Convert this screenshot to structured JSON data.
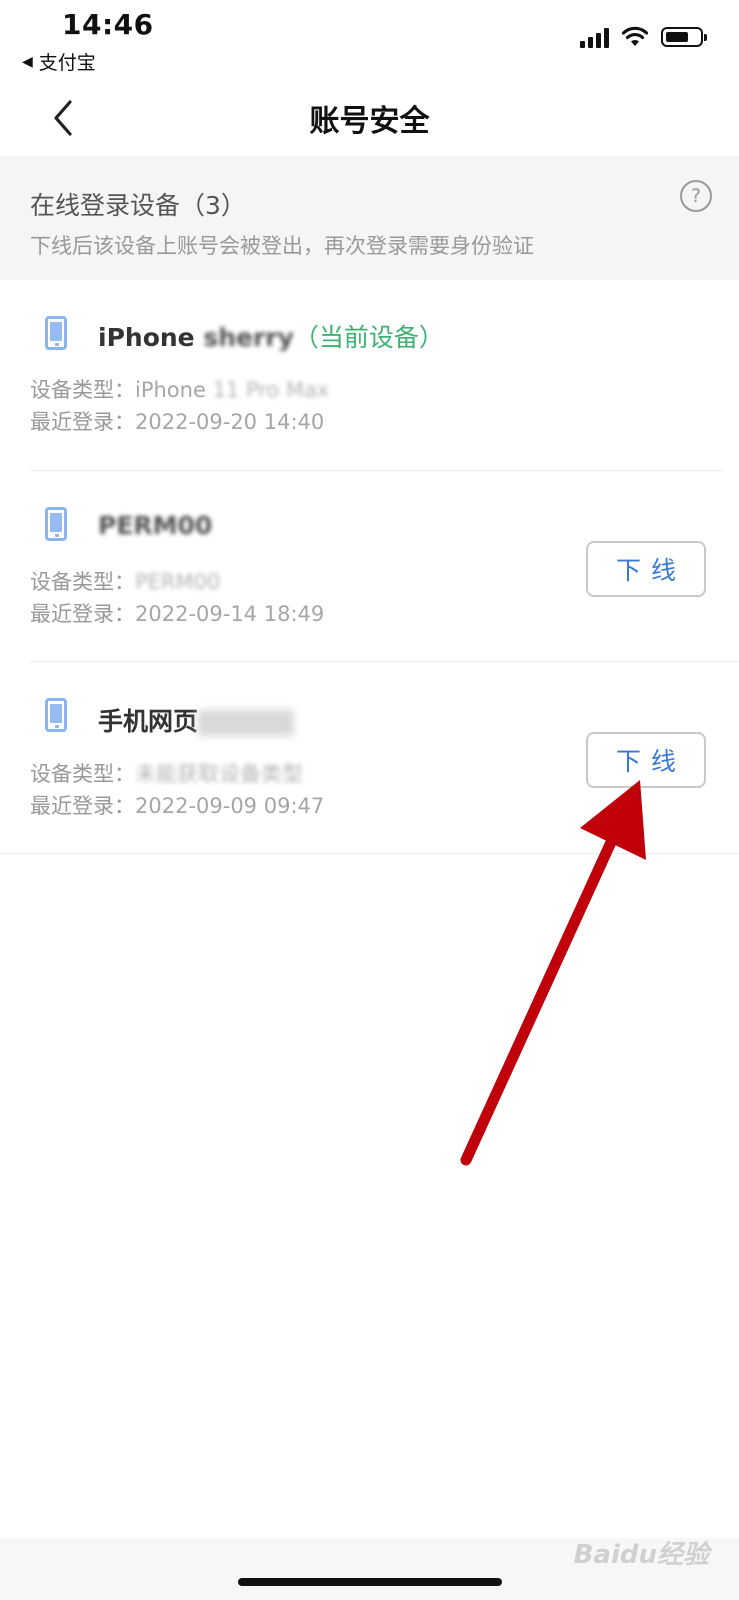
{
  "status_bar": {
    "time": "14:46",
    "back_app": "支付宝"
  },
  "nav": {
    "title": "账号安全",
    "back_icon": "chevron-left-icon"
  },
  "notice": {
    "title": "在线登录设备（3）",
    "subtitle": "下线后该设备上账号会被登出，再次登录需要身份验证",
    "help_icon": "question-circle-icon"
  },
  "labels": {
    "device_type": "设备类型：",
    "last_login": "最近登录："
  },
  "devices": [
    {
      "name": "iPhone ",
      "name_blurred": "sherry",
      "current_tag": "（当前设备）",
      "type": "iPhone ",
      "type_blurred": "11 Pro Max",
      "last_login": "2022-09-20 14:40"
    },
    {
      "name": "PERM00",
      "type": "PERM00",
      "last_login": "2022-09-14 18:49",
      "button": "下线"
    },
    {
      "name": "手机网页",
      "type": "未能获取设备类型",
      "last_login": "2022-09-09 09:47",
      "button": "下线"
    }
  ],
  "colors": {
    "current_device_green": "#3cb371",
    "button_text_blue": "#3a78d8",
    "device_icon_blue": "#8ab4f0",
    "annotation_arrow_red": "#c0000a"
  },
  "watermark": "Baidu经验"
}
